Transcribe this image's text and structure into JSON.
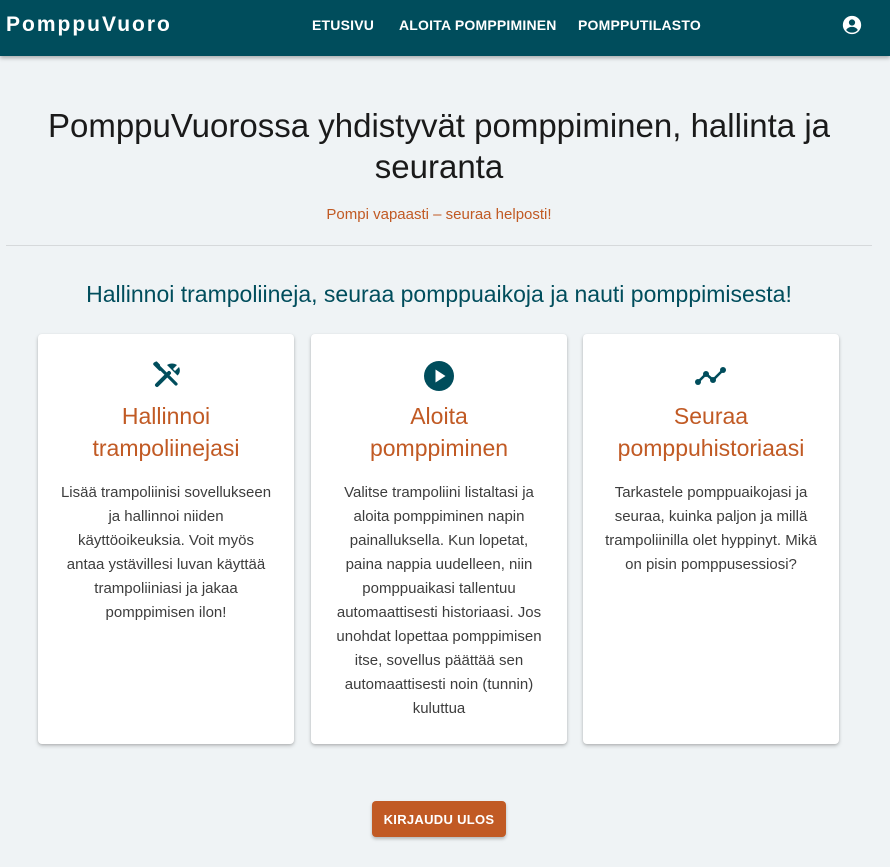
{
  "header": {
    "brand": "PomppuVuoro",
    "nav": [
      "ETUSIVU",
      "ALOITA POMPPIMINEN",
      "POMPPUTILASTO"
    ],
    "account_icon": "account-circle-icon",
    "background_color": "#004d5c"
  },
  "hero": {
    "title": "PomppuVuorossa yhdistyvät pomppiminen, hallinta ja seuranta",
    "subtitle": "Pompi vapaasti – seuraa helposti!"
  },
  "section": {
    "title": "Hallinnoi trampoliineja, seuraa pomppuaikoja ja nauti pomppimisesta!"
  },
  "cards": [
    {
      "icon": "tools-icon",
      "title_line1": "Hallinnoi",
      "title_line2": "trampoliinejasi",
      "text": "Lisää trampoliinisi sovellukseen ja hallinnoi niiden käyttöoikeuksia. Voit myös antaa ystävillesi luvan käyttää trampoliiniasi ja jakaa pomppimisen ilon!"
    },
    {
      "icon": "play-circle-icon",
      "title_line1": "Aloita",
      "title_line2": "pomppiminen",
      "text": "Valitse trampoliini listaltasi ja aloita pomppiminen napin painalluksella. Kun lopetat, paina nappia uudelleen, niin pomppuaikasi tallentuu automaattisesti historiaasi. Jos unohdat lopettaa pomppimisen itse, sovellus päättää sen automaattisesti noin (tunnin) kuluttua"
    },
    {
      "icon": "timeline-icon",
      "title_line1": "Seuraa",
      "title_line2": "pomppuhistoriaasi",
      "text": "Tarkastele pomppuaikojasi ja seuraa, kuinka paljon ja millä trampoliinilla olet hyppinyt. Mikä on pisin pomppusessiosi?"
    }
  ],
  "logout_label": "KIRJAUDU ULOS",
  "colors": {
    "primary": "#004d5c",
    "accent": "#c15a24",
    "background": "#eff3f5"
  }
}
